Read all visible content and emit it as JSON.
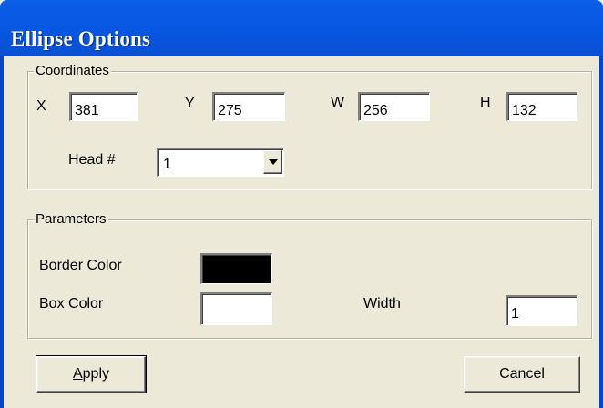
{
  "window": {
    "title": "Ellipse Options"
  },
  "coordinates": {
    "legend": "Coordinates",
    "x_label": "X",
    "x_value": "381",
    "y_label": "Y",
    "y_value": "275",
    "w_label": "W",
    "w_value": "256",
    "h_label": "H",
    "h_value": "132",
    "head_label": "Head #",
    "head_value": "1"
  },
  "parameters": {
    "legend": "Parameters",
    "border_color_label": "Border Color",
    "border_color": "#000000",
    "box_color_label": "Box Color",
    "box_color": "#ffffff",
    "width_label": "Width",
    "width_value": "1"
  },
  "buttons": {
    "apply_label": "Apply",
    "cancel_label": "Cancel"
  }
}
